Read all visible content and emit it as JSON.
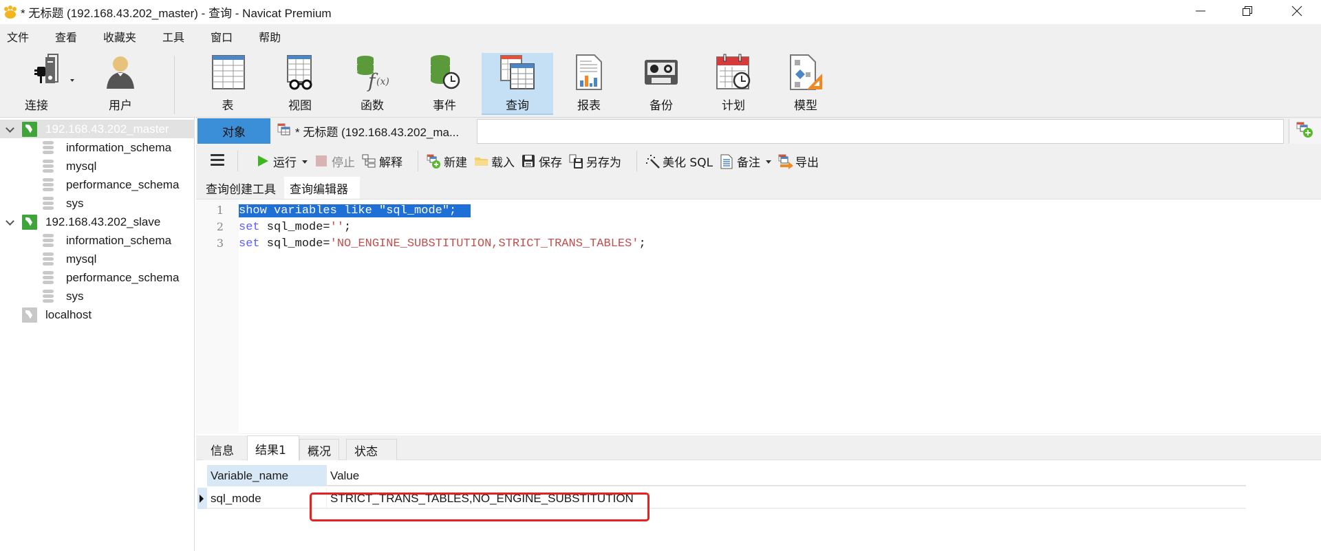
{
  "window": {
    "title": "* 无标题 (192.168.43.202_master) - 查询 - Navicat Premium",
    "controls": {
      "minimize": "minimize-icon",
      "restore": "restore-icon",
      "close": "close-icon"
    }
  },
  "menu": [
    "文件",
    "查看",
    "收藏夹",
    "工具",
    "窗口",
    "帮助"
  ],
  "ribbon": {
    "buttons": [
      {
        "label": "连接",
        "icon": "connection-icon"
      },
      {
        "label": "用户",
        "icon": "user-icon"
      },
      {
        "label": "表",
        "icon": "table-icon"
      },
      {
        "label": "视图",
        "icon": "view-icon"
      },
      {
        "label": "函数",
        "icon": "function-icon"
      },
      {
        "label": "事件",
        "icon": "event-icon"
      },
      {
        "label": "查询",
        "icon": "query-icon",
        "active": true
      },
      {
        "label": "报表",
        "icon": "report-icon"
      },
      {
        "label": "备份",
        "icon": "backup-icon"
      },
      {
        "label": "计划",
        "icon": "schedule-icon"
      },
      {
        "label": "模型",
        "icon": "model-icon"
      }
    ]
  },
  "sidebar": {
    "connections": [
      {
        "name": "192.168.43.202_master",
        "expanded": true,
        "selected": true,
        "databases": [
          "information_schema",
          "mysql",
          "performance_schema",
          "sys"
        ]
      },
      {
        "name": "192.168.43.202_slave",
        "expanded": true,
        "databases": [
          "information_schema",
          "mysql",
          "performance_schema",
          "sys"
        ]
      },
      {
        "name": "localhost",
        "expanded": false,
        "databases": []
      }
    ]
  },
  "tabs": {
    "objects": "对象",
    "query_tab": "* 无标题 (192.168.43.202_ma..."
  },
  "toolbar": {
    "run": "运行",
    "stop": "停止",
    "explain": "解释",
    "new": "新建",
    "load": "载入",
    "save": "保存",
    "save_as": "另存为",
    "beautify": "美化 SQL",
    "comment": "备注",
    "export": "导出"
  },
  "subtabs": {
    "builder": "查询创建工具",
    "editor": "查询编辑器"
  },
  "editor": {
    "line_numbers": [
      "1",
      "2",
      "3"
    ],
    "lines": [
      {
        "text": "show variables like \"sql_mode\";",
        "selected": true
      },
      {
        "kw": "set",
        "rest": " sql_mode=",
        "str": "''",
        "end": ";"
      },
      {
        "kw": "set",
        "rest": " sql_mode=",
        "str": "'NO_ENGINE_SUBSTITUTION,STRICT_TRANS_TABLES'",
        "end": ";"
      }
    ]
  },
  "results": {
    "tabs": [
      "信息",
      "结果1",
      "概况",
      "状态"
    ],
    "active_tab": "结果1",
    "columns": [
      "Variable_name",
      "Value"
    ],
    "rows": [
      {
        "Variable_name": "sql_mode",
        "Value": "STRICT_TRANS_TABLES,NO_ENGINE_SUBSTITUTION"
      }
    ]
  },
  "colors": {
    "accent": "#3b8fd9",
    "selection": "#1e6fd6",
    "keyword": "#5c5cff",
    "string": "#c0504d",
    "highlight_box": "#e8201f",
    "mysql_green": "#3fa53b"
  }
}
